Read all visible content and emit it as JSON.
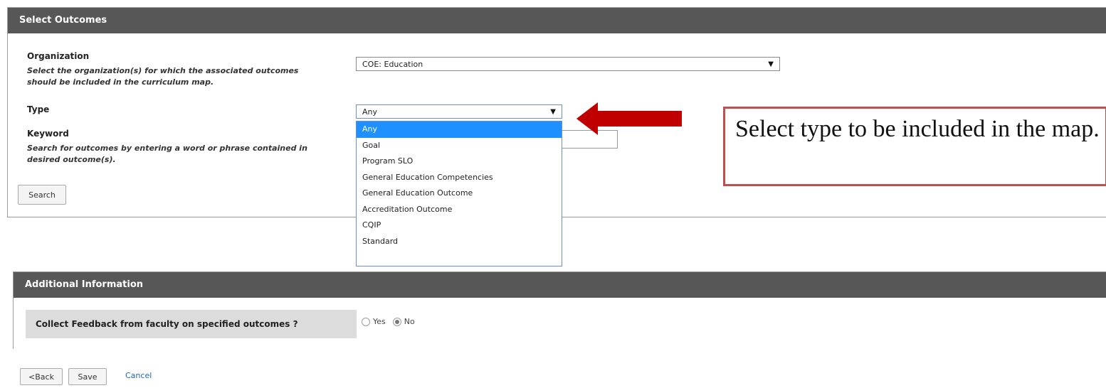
{
  "select_outcomes": {
    "header": "Select Outcomes",
    "organization_label": "Organization",
    "organization_help": "Select the organization(s) for which the associated outcomes should be included in the curriculum map.",
    "organization_value": "COE: Education",
    "type_label": "Type",
    "type_value": "Any",
    "type_options": [
      "Any",
      "Goal",
      "Program SLO",
      "General Education Competencies",
      "General Education Outcome",
      "Accreditation Outcome",
      "CQIP",
      "Standard"
    ],
    "type_highlighted_option": "Any",
    "keyword_label": "Keyword",
    "keyword_help": "Search for outcomes by entering a word or phrase contained in desired outcome(s).",
    "keyword_value": "",
    "search_button": "Search"
  },
  "callout": {
    "text": "Select type to be included in the map.",
    "border_color": "#c05050",
    "arrow_color": "#c00000"
  },
  "additional_info": {
    "header": "Additional Information",
    "feedback_label": "Collect Feedback from faculty on specified outcomes ?",
    "yes_label": "Yes",
    "no_label": "No",
    "selected": "No"
  },
  "footer": {
    "back_button": "<Back",
    "save_button": "Save",
    "cancel_link": "Cancel"
  },
  "colors": {
    "header_bg": "#575757",
    "highlight": "#1e90ff",
    "link": "#2266bb"
  }
}
